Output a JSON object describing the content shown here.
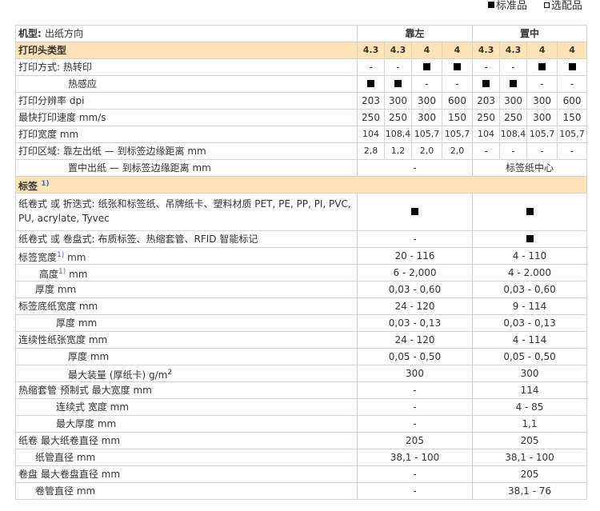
{
  "legend": {
    "standard": "标准品",
    "optional": "选配品"
  },
  "header": {
    "model_label": "机型",
    "model_sep": ":",
    "model_text": "出纸方向",
    "left": "靠左",
    "center": "置中"
  },
  "head_type": {
    "label": "打印头类型",
    "values": [
      "4.3",
      "4.3",
      "4",
      "4",
      "4.3",
      "4.3",
      "4",
      "4"
    ]
  },
  "print_method": {
    "label": "打印方式:",
    "thermal_transfer": "热转印",
    "direct_thermal": "热感应",
    "tt_values": [
      "-",
      "-",
      "■",
      "■",
      "-",
      "-",
      "■",
      "■"
    ],
    "dt_values": [
      "■",
      "■",
      "-",
      "-",
      "■",
      "■",
      "-",
      "-"
    ]
  },
  "resolution": {
    "label": "打印分辨率",
    "unit": "dpi",
    "values": [
      "203",
      "300",
      "300",
      "600",
      "203",
      "300",
      "300",
      "600"
    ]
  },
  "speed": {
    "label": "最快打印速度",
    "unit": "mm/s",
    "values": [
      "250",
      "250",
      "300",
      "150",
      "250",
      "250",
      "300",
      "150"
    ]
  },
  "width": {
    "label": "打印宽度",
    "unit": "mm",
    "values": [
      "104",
      "108,4",
      "105,7",
      "105,7",
      "104",
      "108,4",
      "105,7",
      "105,7"
    ]
  },
  "area": {
    "label": "打印区域:",
    "left_label": "靠左出纸 — 到标签边缘距离",
    "center_label": "置中出纸 — 到标签边缘距离",
    "unit": "mm",
    "left_values": [
      "2,8",
      "1,2",
      "2,0",
      "2,0",
      "-",
      "-",
      "-",
      "-"
    ],
    "center_left": "-",
    "center_center": "标签纸中心"
  },
  "label_section": {
    "label": "标签",
    "note": "1)"
  },
  "roll_fanfold": {
    "label": "纸卷式 或 折迭式: 纸张和标签纸、吊牌纸卡、塑料材质 PET, PE, PP, PI, PVC, PU, acrylate, Tyvec"
  },
  "roll_reel": {
    "label": "纸卷式 或 卷盘式: 布质标签、热缩套管、RFID 智能标记",
    "left": "-"
  },
  "label_width": {
    "label": "标签宽度",
    "note": "1)",
    "unit": "mm",
    "left": "20 - 116",
    "center": "4 - 110"
  },
  "label_height": {
    "label": "高度",
    "note": "1)",
    "unit": "mm",
    "left": "6 - 2,000",
    "center": "4 - 2.000"
  },
  "label_thick": {
    "label": "厚度",
    "unit": "mm",
    "left": "0,03 - 0,60",
    "center": "0,03 - 0,60"
  },
  "liner_width": {
    "label": "标签底纸宽度",
    "unit": "mm",
    "left": "24 - 120",
    "center": "9 - 114"
  },
  "liner_thick": {
    "label": "厚度",
    "unit": "mm",
    "left": "0,03 - 0,13",
    "center": "0,03 - 0,13"
  },
  "cont_width": {
    "label": "连续性纸张宽度",
    "unit": "mm",
    "left": "24 - 120",
    "center": "4 - 114"
  },
  "cont_thick": {
    "label": "厚度",
    "unit": "mm",
    "left": "0,05 - 0,50",
    "center": "0,05 - 0,50"
  },
  "max_load": {
    "label": "最大装量 (厚纸卡)",
    "unit": "g/m",
    "exp": "2",
    "left": "300",
    "center": "300"
  },
  "sleeve_pre": {
    "label": "热缩套管 预制式 最大宽度",
    "unit": "mm",
    "left": "-",
    "center": "114"
  },
  "sleeve_cont": {
    "label": "连续式 宽度",
    "unit": "mm",
    "left": "-",
    "center": "4 - 85"
  },
  "sleeve_thick": {
    "label": "最大厚度",
    "unit": "mm",
    "left": "-",
    "center": "1,1"
  },
  "roll_dia": {
    "label": "纸卷 最大纸卷直径",
    "unit": "mm",
    "left": "205",
    "center": "205"
  },
  "core_dia": {
    "label": "纸管直径",
    "unit": "mm",
    "left": "38,1 - 100",
    "center": "38,1 - 100"
  },
  "reel_dia": {
    "label": "卷盘 最大卷盘直径",
    "unit": "mm",
    "left": "-",
    "center": "205"
  },
  "reel_core": {
    "label": "卷管直径",
    "unit": "mm",
    "left": "-",
    "center": "38,1 - 76"
  }
}
